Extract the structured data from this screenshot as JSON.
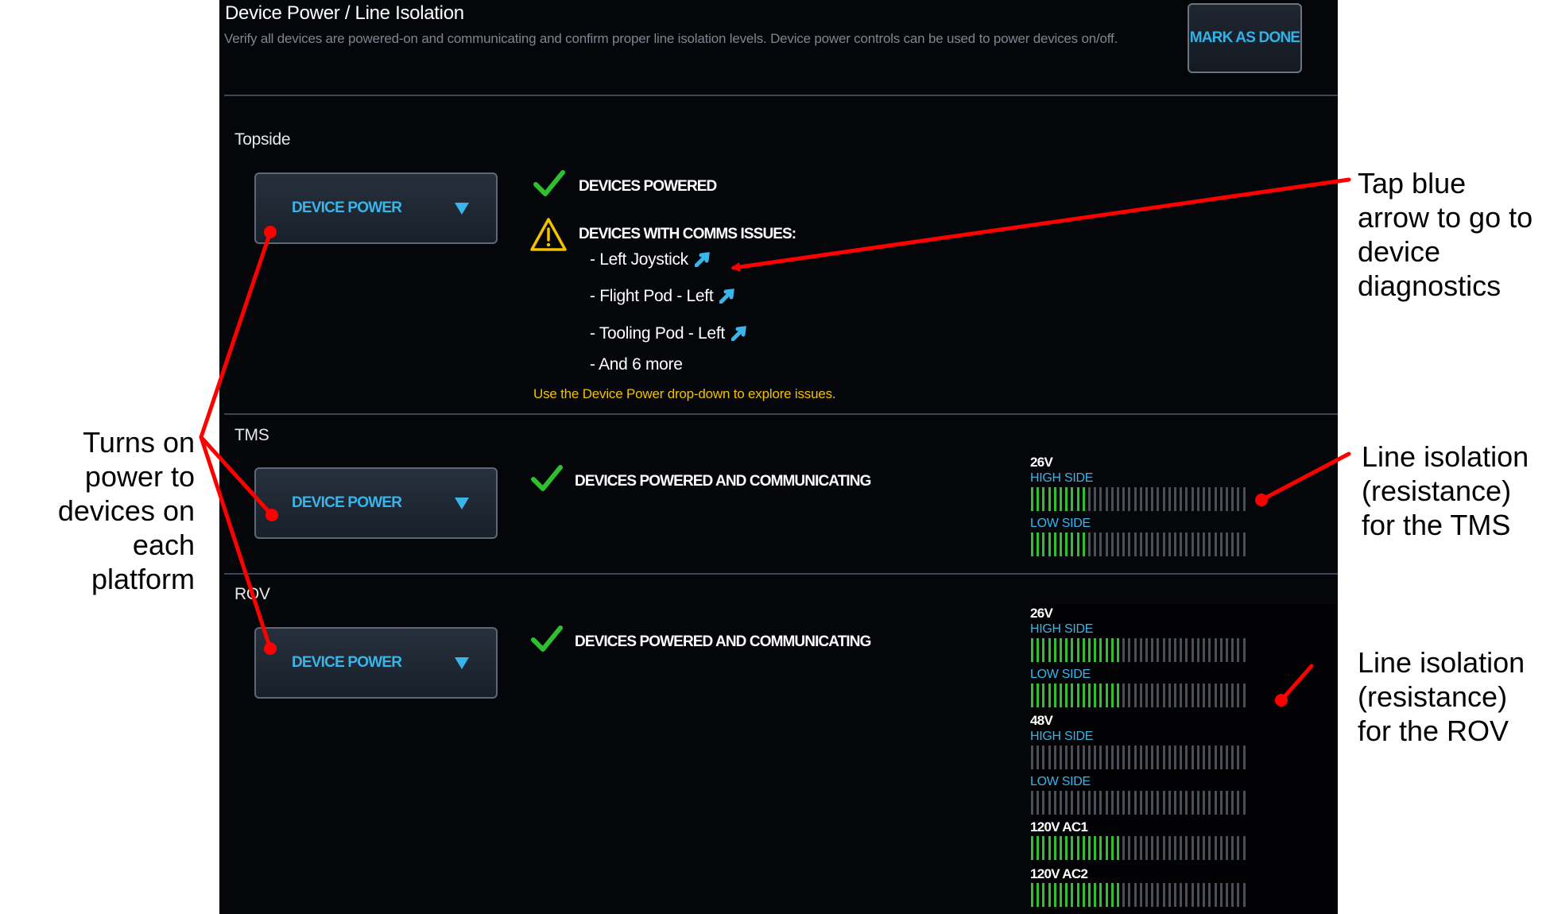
{
  "header": {
    "title": "Device Power / Line Isolation",
    "subtitle": "Verify all devices are powered-on and communicating and confirm proper line isolation levels.  Device power controls can be used to power devices on/off.",
    "mark_done": "MARK AS DONE"
  },
  "topside": {
    "label": "Topside",
    "device_power": "DEVICE POWER",
    "status_powered": "DEVICES POWERED",
    "status_comms": "DEVICES WITH COMMS ISSUES:",
    "issues": [
      "- Left Joystick",
      "- Flight Pod - Left",
      "- Tooling Pod - Left",
      "- And 6 more"
    ],
    "hint": "Use the Device Power drop-down to explore issues."
  },
  "tms": {
    "label": "TMS",
    "device_power": "DEVICE POWER",
    "status": "DEVICES POWERED AND COMMUNICATING",
    "isolation": [
      {
        "voltage": "26V",
        "high_label": "HIGH SIDE",
        "high_level": 0.25,
        "low_label": "LOW SIDE",
        "low_level": 0.25
      }
    ]
  },
  "rov": {
    "label": "ROV",
    "device_power": "DEVICE POWER",
    "status": "DEVICES POWERED AND COMMUNICATING",
    "isolation": [
      {
        "voltage": "26V",
        "high_label": "HIGH SIDE",
        "high_level": 0.43,
        "low_label": "LOW SIDE",
        "low_level": 0.43
      },
      {
        "voltage": "48V",
        "high_label": "HIGH SIDE",
        "high_level": 0.0,
        "low_label": "LOW SIDE",
        "low_level": 0.0
      },
      {
        "voltage": "120V AC1",
        "level": 0.41
      },
      {
        "voltage": "120V AC2",
        "level": 0.41
      }
    ]
  },
  "annotations": {
    "turns_on": "Turns on power to devices on each platform",
    "tap_blue": "Tap blue arrow to go to device diagnostics",
    "line_tms": "Line isolation (resistance) for the TMS",
    "line_rov": "Line isolation (resistance) for the ROV"
  },
  "colors": {
    "accent": "#39b5ea",
    "ok": "#2fbf2f",
    "warn": "#f2c100",
    "annotation": "#ff0000"
  }
}
